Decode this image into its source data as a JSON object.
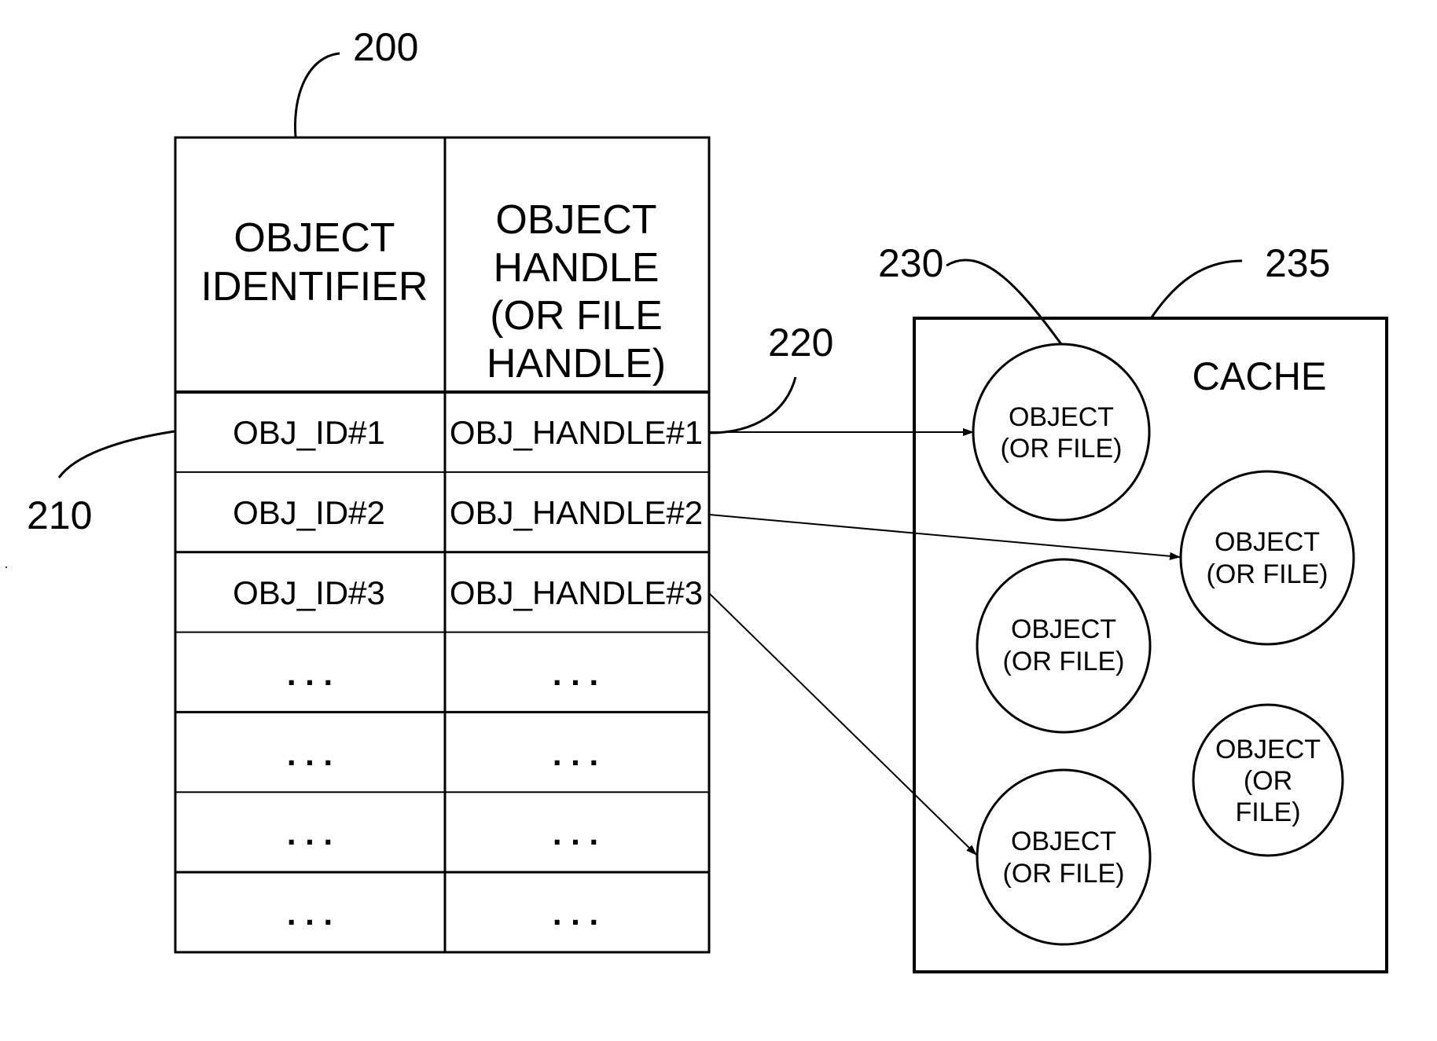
{
  "figure": {
    "table": {
      "ref": "200",
      "rows_ref": "210",
      "handle_ref": "220",
      "headers": [
        {
          "lines": [
            "OBJECT",
            "IDENTIFIER"
          ]
        },
        {
          "lines": [
            "OBJECT",
            "HANDLE",
            "(OR FILE",
            "HANDLE)"
          ]
        }
      ],
      "rows": [
        {
          "id": "OBJ_ID#1",
          "handle": "OBJ_HANDLE#1"
        },
        {
          "id": "OBJ_ID#2",
          "handle": "OBJ_HANDLE#2"
        },
        {
          "id": "OBJ_ID#3",
          "handle": "OBJ_HANDLE#3"
        },
        {
          "id": ". . .",
          "handle": ". . ."
        },
        {
          "id": ". . .",
          "handle": ". . ."
        },
        {
          "id": ". . .",
          "handle": ". . ."
        },
        {
          "id": ". . .",
          "handle": ". . ."
        }
      ]
    },
    "cache": {
      "label": "CACHE",
      "ref": "235",
      "object_ref": "230",
      "objects": [
        {
          "lines": [
            "OBJECT",
            "(OR FILE)"
          ]
        },
        {
          "lines": [
            "OBJECT",
            "(OR FILE)"
          ]
        },
        {
          "lines": [
            "OBJECT",
            "(OR FILE)"
          ]
        },
        {
          "lines": [
            "OBJECT",
            "(OR",
            "FILE)"
          ]
        },
        {
          "lines": [
            "OBJECT",
            "(OR FILE)"
          ]
        }
      ]
    },
    "arrows": [
      {
        "from": "OBJ_HANDLE#1",
        "to_object": 0
      },
      {
        "from": "OBJ_HANDLE#2",
        "to_object": 1
      },
      {
        "from": "OBJ_HANDLE#3",
        "to_object": 4
      }
    ]
  }
}
